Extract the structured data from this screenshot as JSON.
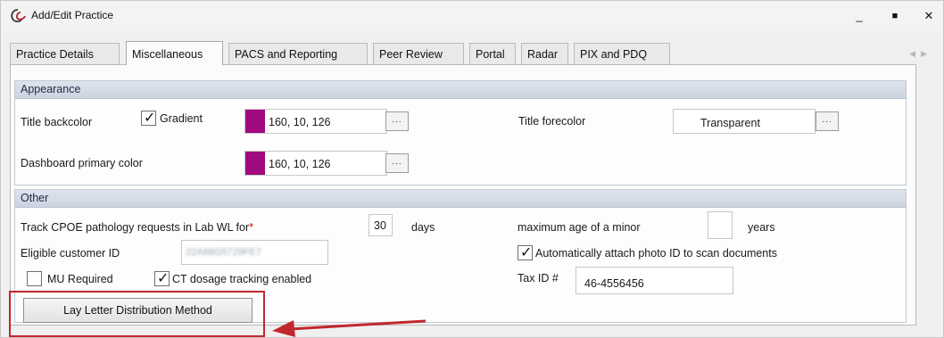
{
  "window": {
    "title": "Add/Edit Practice",
    "minimize_glyph": "_",
    "maximize_glyph": "■",
    "close_glyph": "✕"
  },
  "tabs": [
    {
      "label": "Practice Details",
      "active": false
    },
    {
      "label": "Miscellaneous",
      "active": true
    },
    {
      "label": "PACS and Reporting",
      "active": false
    },
    {
      "label": "Peer Review",
      "active": false
    },
    {
      "label": "Portal",
      "active": false
    },
    {
      "label": "Radar",
      "active": false
    },
    {
      "label": "PIX and PDQ",
      "active": false
    }
  ],
  "tab_scroll": {
    "left": "◀",
    "right": "▶"
  },
  "appearance": {
    "header": "Appearance",
    "title_backcolor_label": "Title backcolor",
    "gradient_label": "Gradient",
    "gradient_checked": true,
    "title_backcolor_value": "160, 10, 126",
    "title_backcolor_hex": "#a00a7e",
    "browse_label": "...",
    "title_forecolor_label": "Title forecolor",
    "title_forecolor_value": "Transparent",
    "dashboard_color_label": "Dashboard primary color",
    "dashboard_color_value": "160, 10, 126",
    "dashboard_color_hex": "#a00a7e"
  },
  "other": {
    "header": "Other",
    "track_cpoe_label": "Track CPOE pathology requests in Lab WL for",
    "required_marker": "*",
    "track_cpoe_value": "30",
    "days_label": "days",
    "max_age_label": "maximum age of a minor",
    "max_age_value": "",
    "years_label": "years",
    "eligible_customer_label": "Eligible customer ID",
    "eligible_customer_value": "22A88G5729FE7",
    "auto_attach_label": "Automatically attach photo ID to scan documents",
    "auto_attach_checked": true,
    "mu_required_label": "MU Required",
    "mu_required_checked": false,
    "ct_dosage_label": "CT dosage tracking enabled",
    "ct_dosage_checked": true,
    "tax_id_label": "Tax ID #",
    "tax_id_value": "46-4556456",
    "lay_letter_button": "Lay Letter Distribution Method"
  },
  "colors": {
    "annotation_red": "#c0282d",
    "swatch_magenta": "#a00a7e"
  }
}
